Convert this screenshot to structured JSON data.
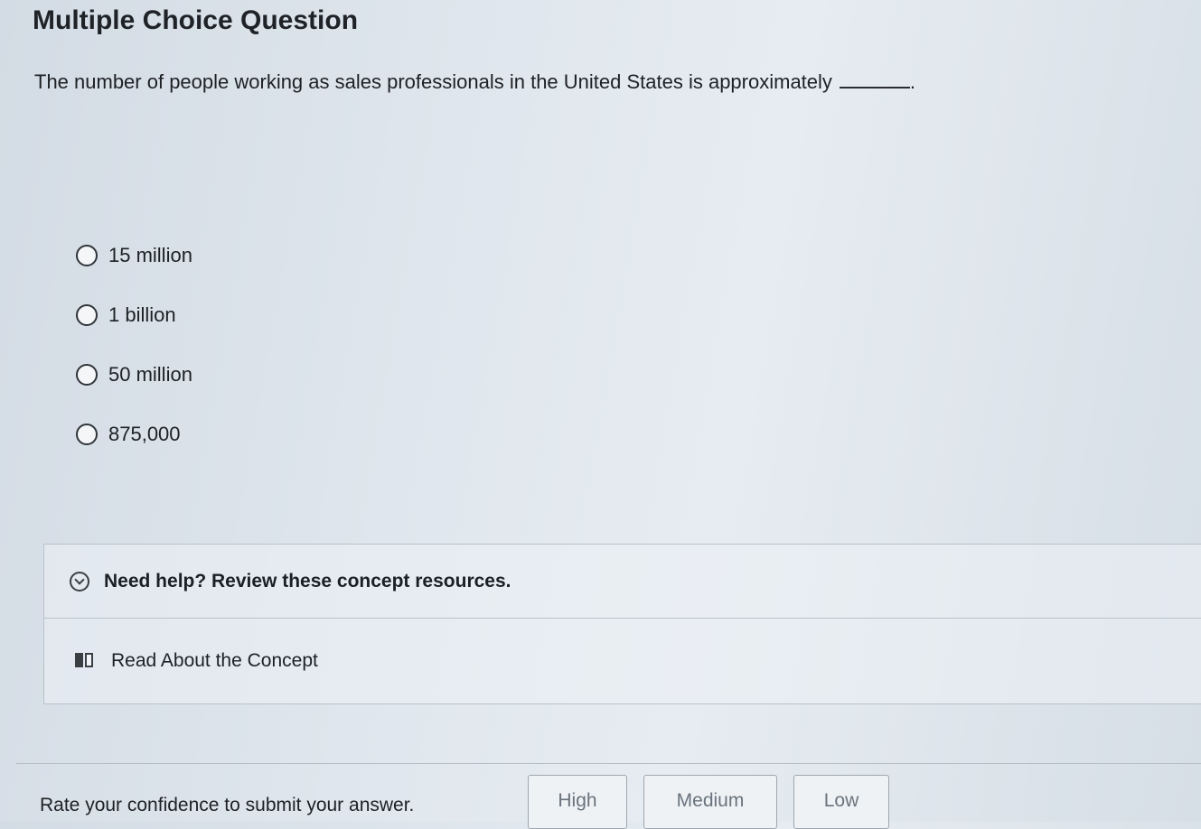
{
  "question": {
    "heading": "Multiple Choice Question",
    "prompt": "The number of people working as sales professionals in the United States is approximately",
    "prompt_end": "."
  },
  "options": [
    {
      "label": "15 million"
    },
    {
      "label": "1 billion"
    },
    {
      "label": "50 million"
    },
    {
      "label": "875,000"
    }
  ],
  "help": {
    "title": "Need help? Review these concept resources.",
    "link_label": "Read About the Concept"
  },
  "confidence": {
    "prompt": "Rate your confidence to submit your answer.",
    "high_label": "High",
    "medium_label": "Medium",
    "low_label": "Low"
  }
}
